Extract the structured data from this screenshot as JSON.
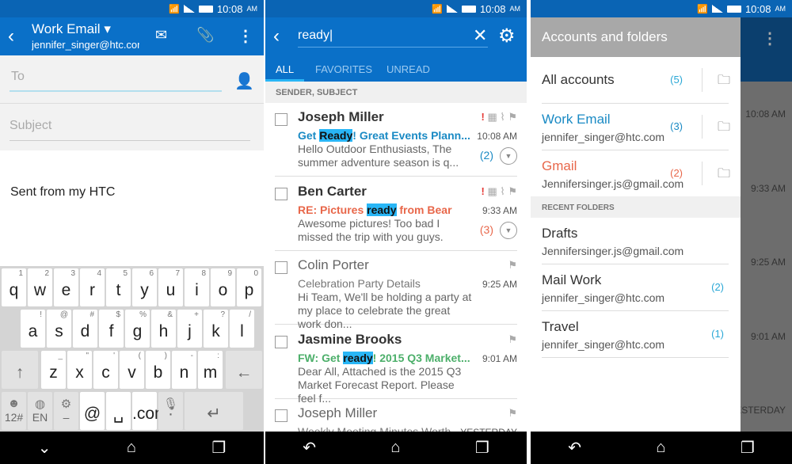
{
  "status": {
    "time": "10:08",
    "ampm": "AM"
  },
  "compose": {
    "title": "Work Email",
    "account": "jennifer_singer@htc.com",
    "to_placeholder": "To",
    "subject_placeholder": "Subject",
    "body": "Sent from my HTC",
    "keyboard": [
      [
        [
          "q",
          "1"
        ],
        [
          "w",
          "2"
        ],
        [
          "e",
          "3"
        ],
        [
          "r",
          "4"
        ],
        [
          "t",
          "5"
        ],
        [
          "y",
          "6"
        ],
        [
          "u",
          "7"
        ],
        [
          "i",
          "8"
        ],
        [
          "o",
          "9"
        ],
        [
          "p",
          "0"
        ]
      ],
      [
        [
          "a",
          "!"
        ],
        [
          "s",
          "@"
        ],
        [
          "d",
          "#"
        ],
        [
          "f",
          "$"
        ],
        [
          "g",
          "%"
        ],
        [
          "h",
          "&"
        ],
        [
          "j",
          "+"
        ],
        [
          "k",
          "?"
        ],
        [
          "l",
          "/"
        ]
      ],
      [
        [
          "↑",
          ""
        ],
        [
          "z",
          "_"
        ],
        [
          "x",
          "\""
        ],
        [
          "c",
          "'"
        ],
        [
          "v",
          "("
        ],
        [
          "b",
          ")"
        ],
        [
          "n",
          "-"
        ],
        [
          "m",
          ":"
        ],
        [
          "←",
          ""
        ]
      ],
      [
        [
          "12#",
          "☻"
        ],
        [
          "EN",
          "◍"
        ],
        [
          "–",
          "⚙"
        ],
        [
          "@",
          ""
        ],
        [
          "␣",
          ""
        ],
        [
          ".com",
          ""
        ],
        [
          "·",
          "🎙"
        ],
        [
          "↵",
          ""
        ]
      ]
    ]
  },
  "search": {
    "query": "ready",
    "tabs": [
      "ALL",
      "FAVORITES",
      "UNREAD"
    ],
    "section": "SENDER, SUBJECT",
    "emails": [
      {
        "sender": "Joseph Miller",
        "pre": "Get ",
        "hl": "Ready",
        "post": "! Great Events Plann...",
        "color": "#1a8ac4",
        "preview": "Hello Outdoor Enthusiasts, The summer adventure season is q...",
        "time": "10:08 AM",
        "count": "(2)",
        "important": true,
        "unread": true
      },
      {
        "sender": "Ben Carter",
        "pre": "RE: Pictures ",
        "hl": "ready",
        "post": " from Bear",
        "color": "#e8674a",
        "preview": "Awesome pictures! Too bad I missed the trip with you guys.",
        "time": "9:33 AM",
        "count": "(3)",
        "important": true,
        "unread": true
      },
      {
        "sender": "Colin Porter",
        "pre": "Celebration Party Details",
        "hl": "",
        "post": "",
        "color": "#777",
        "preview": "Hi Team, We'll be holding a party at my place to celebrate the great work don...",
        "time": "9:25 AM",
        "count": "",
        "important": false,
        "unread": false
      },
      {
        "sender": "Jasmine Brooks",
        "pre": "FW: Get ",
        "hl": "ready",
        "post": "! 2015 Q3 Market...",
        "color": "#4caf6a",
        "preview": "Dear All, Attached is the 2015 Q3 Market Forecast Report. Please feel f...",
        "time": "9:01 AM",
        "count": "",
        "important": false,
        "unread": true
      },
      {
        "sender": "Joseph Miller",
        "pre": "Weekly Meeting Minutes Worth...",
        "hl": "",
        "post": "",
        "color": "#777",
        "preview": "",
        "time": "YESTERDAY",
        "count": "",
        "important": false,
        "unread": false
      }
    ]
  },
  "drawer": {
    "title": "Accounts and folders",
    "recent_header": "RECENT FOLDERS",
    "accounts": [
      {
        "name": "All accounts",
        "email": "",
        "count": "(5)",
        "color": "#333",
        "count_color": "#29a7d6"
      },
      {
        "name": "Work Email",
        "email": "jennifer_singer@htc.com",
        "count": "(3)",
        "color": "#1a8ac4",
        "count_color": "#1a8ac4"
      },
      {
        "name": "Gmail",
        "email": "Jennifersinger.js@gmail.com",
        "count": "(2)",
        "color": "#e8674a",
        "count_color": "#e8674a"
      }
    ],
    "folders": [
      {
        "name": "Drafts",
        "email": "Jennifersinger.js@gmail.com",
        "count": ""
      },
      {
        "name": "Mail Work",
        "email": "jennifer_singer@htc.com",
        "count": "(2)"
      },
      {
        "name": "Travel",
        "email": "jennifer_singer@htc.com",
        "count": "(1)"
      }
    ],
    "behind_times": [
      "10:08 AM",
      "9:33 AM",
      "9:25 AM",
      "9:01 AM",
      "ESTERDAY"
    ]
  },
  "colors": {
    "appbar": "#0a70c8",
    "status": "#0a64b4",
    "highlight": "#29b6f6"
  }
}
